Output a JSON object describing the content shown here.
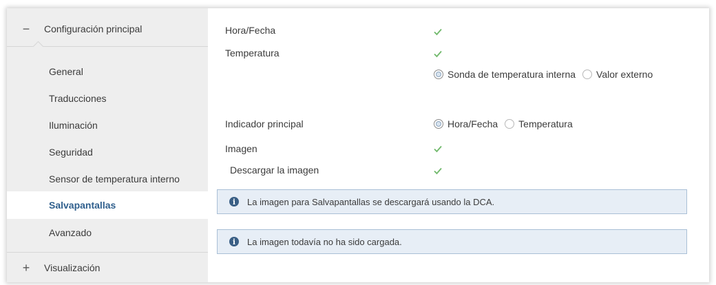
{
  "sidebar": {
    "groups": [
      {
        "toggle": "−",
        "label": "Configuración principal"
      },
      {
        "toggle": "+",
        "label": "Visualización"
      }
    ],
    "items": [
      {
        "label": "General"
      },
      {
        "label": "Traducciones"
      },
      {
        "label": "Iluminación"
      },
      {
        "label": "Seguridad"
      },
      {
        "label": "Sensor de temperatura interno"
      },
      {
        "label": "Salvapantallas",
        "active": true
      },
      {
        "label": "Avanzado"
      }
    ]
  },
  "main": {
    "hora_fecha": {
      "label": "Hora/Fecha",
      "checked": true
    },
    "temperatura": {
      "label": "Temperatura",
      "checked": true,
      "options": [
        {
          "label": "Sonda de temperatura interna",
          "selected": true
        },
        {
          "label": "Valor externo",
          "selected": false
        }
      ]
    },
    "indicador_principal": {
      "label": "Indicador principal",
      "options": [
        {
          "label": "Hora/Fecha",
          "selected": true
        },
        {
          "label": "Temperatura",
          "selected": false
        }
      ]
    },
    "imagen": {
      "label": "Imagen",
      "checked": true
    },
    "descargar_imagen": {
      "label": "Descargar la imagen",
      "checked": true
    },
    "info_messages": [
      "La imagen para Salvapantallas se descargará usando la DCA.",
      "La imagen todavía no ha sido cargada."
    ]
  },
  "colors": {
    "sidebar_bg": "#eeeeee",
    "active_text": "#2f5f8d",
    "check_green": "#6fb86a",
    "info_bg": "#e7eef6",
    "info_border": "#a9bfd6",
    "info_icon": "#3a5f85"
  },
  "icons": {
    "check": "checkmark-icon",
    "info": "info-icon"
  }
}
